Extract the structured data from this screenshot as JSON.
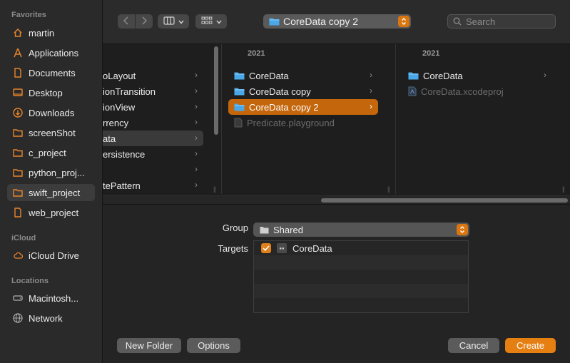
{
  "sidebar": {
    "favorites_title": "Favorites",
    "favorites": [
      {
        "label": "martin",
        "icon": "home-icon"
      },
      {
        "label": "Applications",
        "icon": "applications-icon"
      },
      {
        "label": "Documents",
        "icon": "document-icon"
      },
      {
        "label": "Desktop",
        "icon": "desktop-icon"
      },
      {
        "label": "Downloads",
        "icon": "downloads-icon"
      },
      {
        "label": "screenShot",
        "icon": "folder-icon"
      },
      {
        "label": "c_project",
        "icon": "folder-icon"
      },
      {
        "label": "python_proj...",
        "icon": "folder-icon"
      },
      {
        "label": "swift_project",
        "icon": "folder-icon",
        "selected": true
      },
      {
        "label": "web_project",
        "icon": "document-icon"
      }
    ],
    "icloud_title": "iCloud",
    "icloud": [
      {
        "label": "iCloud Drive",
        "icon": "cloud-icon"
      }
    ],
    "locations_title": "Locations",
    "locations": [
      {
        "label": "Macintosh...",
        "icon": "disk-icon"
      },
      {
        "label": "Network",
        "icon": "globe-icon"
      }
    ]
  },
  "toolbar": {
    "back_icon": "chevron-left-icon",
    "forward_icon": "chevron-right-icon",
    "view_icon": "columns-view-icon",
    "group_icon": "icon-grid-icon",
    "path": "CoreData copy 2",
    "search_placeholder": "Search"
  },
  "browser": {
    "column1": {
      "items": [
        "oLayout",
        "ionTransition",
        "ionView",
        "rrency",
        "ata",
        "ersistence",
        "",
        "tePattern"
      ],
      "selected_index": 4
    },
    "column2": {
      "header": "2021",
      "items": [
        {
          "label": "CoreData",
          "type": "folder"
        },
        {
          "label": "CoreData copy",
          "type": "folder"
        },
        {
          "label": "CoreData copy 2",
          "type": "folder",
          "selected": true
        },
        {
          "label": "Predicate.playground",
          "type": "file",
          "dim": true
        }
      ]
    },
    "column3": {
      "header": "2021",
      "items": [
        {
          "label": "CoreData",
          "type": "folder"
        },
        {
          "label": "CoreData.xcodeproj",
          "type": "file",
          "dim": true
        }
      ]
    }
  },
  "options": {
    "group_label": "Group",
    "group_value": "Shared",
    "targets_label": "Targets",
    "targets": [
      {
        "label": "CoreData",
        "checked": true
      }
    ]
  },
  "buttons": {
    "new_folder": "New Folder",
    "options": "Options",
    "cancel": "Cancel",
    "create": "Create"
  },
  "colors": {
    "accent": "#e67f12",
    "selection": "#c4660c",
    "folder": "#4aa8e8"
  }
}
